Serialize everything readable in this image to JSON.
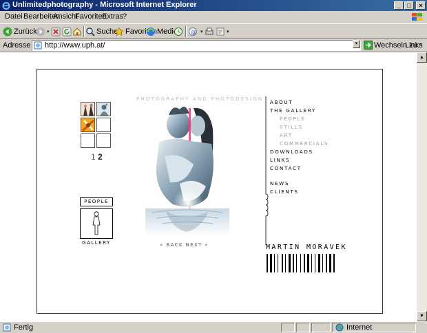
{
  "window": {
    "title": "Unlimitedphotography - Microsoft Internet Explorer",
    "min_glyph": "_",
    "max_glyph": "□",
    "close_glyph": "×"
  },
  "menu": [
    "Datei",
    "Bearbeiten",
    "Ansicht",
    "Favoriten",
    "Extras",
    "?"
  ],
  "toolbar": {
    "back": "Zurück",
    "search": "Suchen",
    "favorites": "Favoriten",
    "media": "Medien",
    "arrow": "▾"
  },
  "address": {
    "label": "Adresse",
    "url": "http://www.uph.at/",
    "go": "Wechseln zu",
    "links": "Links",
    "links_chevron": "»"
  },
  "scroll": {
    "up": "▲",
    "down": "▼"
  },
  "status": {
    "text": "Fertig",
    "zone": "Internet"
  },
  "page": {
    "tagline": "photography and photodesign",
    "pages": {
      "first": "1",
      "second": "2"
    },
    "people_label": "people",
    "gallery_label": "gallery",
    "back_next": "« back   next »",
    "nav": [
      {
        "label": "about",
        "sub": false
      },
      {
        "label": "the gallery",
        "sub": false
      },
      {
        "label": "people",
        "sub": true
      },
      {
        "label": "stills",
        "sub": true
      },
      {
        "label": "art",
        "sub": true
      },
      {
        "label": "commercials",
        "sub": true
      },
      {
        "label": "downloads",
        "sub": false
      },
      {
        "label": "links",
        "sub": false
      },
      {
        "label": "contact",
        "sub": false
      },
      {
        "label": "news",
        "sub": false
      },
      {
        "label": "clients",
        "sub": false
      }
    ],
    "signature": "martin moravek"
  },
  "colors": {
    "titlebar_start": "#0a246a",
    "titlebar_end": "#3a6ea5",
    "chrome": "#d4d0c8",
    "accent_pink": "#e0407a"
  }
}
